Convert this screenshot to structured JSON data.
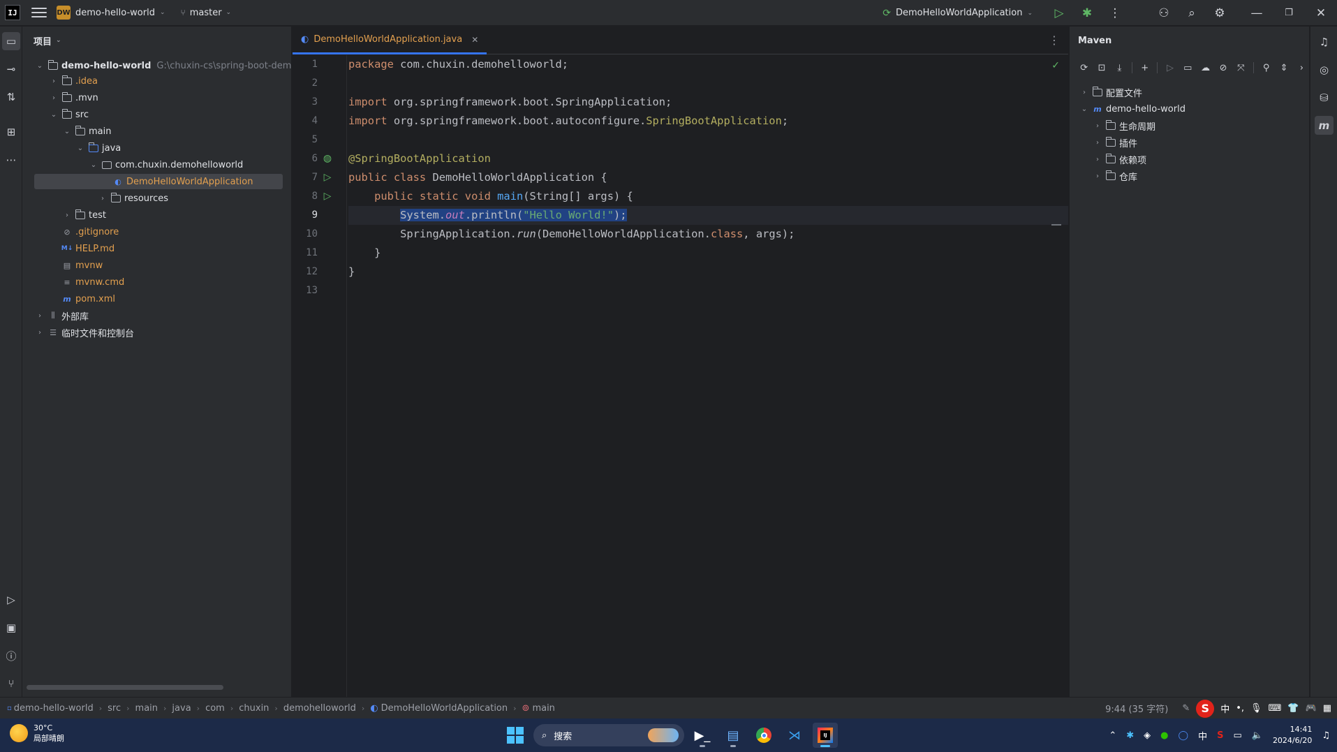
{
  "titlebar": {
    "logo": "IJ",
    "project_badge": "DW",
    "project_name": "demo-hello-world",
    "branch": "master",
    "run_config": "DemoHelloWorldApplication",
    "icons": [
      "run-icon",
      "debug-icon",
      "more-icon",
      "add-user-icon",
      "search-icon",
      "settings-icon",
      "minimize-icon",
      "restore-icon",
      "close-icon"
    ]
  },
  "project_panel": {
    "title": "项目",
    "tree": [
      {
        "label": "demo-hello-world",
        "hint": "G:\\chuxin-cs\\spring-boot-demo",
        "icon": "module-icon"
      },
      {
        "label": ".idea",
        "icon": "folder-icon"
      },
      {
        "label": ".mvn",
        "icon": "folder-icon"
      },
      {
        "label": "src",
        "icon": "folder-icon"
      },
      {
        "label": "main",
        "icon": "folder-icon"
      },
      {
        "label": "java",
        "icon": "source-folder-icon"
      },
      {
        "label": "com.chuxin.demohelloworld",
        "icon": "package-icon"
      },
      {
        "label": "DemoHelloWorldApplication",
        "icon": "spring-class-icon"
      },
      {
        "label": "resources",
        "icon": "resources-folder-icon"
      },
      {
        "label": "test",
        "icon": "folder-icon"
      },
      {
        "label": ".gitignore",
        "icon": "ignore-file-icon"
      },
      {
        "label": "HELP.md",
        "icon": "markdown-icon"
      },
      {
        "label": "mvnw",
        "icon": "script-icon"
      },
      {
        "label": "mvnw.cmd",
        "icon": "text-file-icon"
      },
      {
        "label": "pom.xml",
        "icon": "maven-file-icon"
      },
      {
        "label": "外部库",
        "icon": "library-icon"
      },
      {
        "label": "临时文件和控制台",
        "icon": "scratches-icon"
      }
    ]
  },
  "editor": {
    "tab_label": "DemoHelloWorldApplication.java",
    "line_numbers": [
      "1",
      "2",
      "3",
      "4",
      "5",
      "6",
      "7",
      "8",
      "9",
      "10",
      "11",
      "12",
      "13"
    ],
    "code": {
      "l1_kw": "package",
      "l1_rest": " com.chuxin.demohelloworld;",
      "l3_kw": "import",
      "l3_rest": " org.springframework.boot.SpringApplication;",
      "l4_kw": "import",
      "l4_mid": " org.springframework.boot.autoconfigure.",
      "l4_ann": "SpringBootApplication",
      "l4_end": ";",
      "l6_ann": "@SpringBootApplication",
      "l7_kw": "public class",
      "l7_rest": " DemoHelloWorldApplication {",
      "l8_indent": "    ",
      "l8_kw": "public static void",
      "l8_fn": "main",
      "l8_rest": "(String[] args) {",
      "l9_indent": "        ",
      "l9_a": "System.",
      "l9_out": "out",
      "l9_b": ".println(",
      "l9_str": "\"Hello World!\"",
      "l9_c": ");",
      "l10_indent": "        ",
      "l10_a": "SpringApplication.",
      "l10_run": "run",
      "l10_b": "(DemoHelloWorldApplication.",
      "l10_kw": "class",
      "l10_c": ", args);",
      "l11": "    }",
      "l12": "}"
    }
  },
  "maven": {
    "title": "Maven",
    "tree": [
      {
        "label": "配置文件"
      },
      {
        "label": "demo-hello-world"
      },
      {
        "label": "生命周期"
      },
      {
        "label": "插件"
      },
      {
        "label": "依赖项"
      },
      {
        "label": "仓库"
      }
    ]
  },
  "statusbar": {
    "breadcrumbs": [
      "demo-hello-world",
      "src",
      "main",
      "java",
      "com",
      "chuxin",
      "demohelloworld",
      "DemoHelloWorldApplication",
      "main"
    ],
    "position": "9:44 (35 字符)",
    "ime_lang": "中"
  },
  "taskbar": {
    "temperature": "30°C",
    "weather": "局部晴朗",
    "search_placeholder": "搜索",
    "tray_lang": "中",
    "time": "14:41",
    "date": "2024/6/20"
  },
  "colors": {
    "accent": "#3574f0",
    "keyword": "#cf8e6d",
    "annotation": "#b3ae60",
    "string": "#6aab73",
    "function": "#56a8f5",
    "run_green": "#5fb865"
  }
}
